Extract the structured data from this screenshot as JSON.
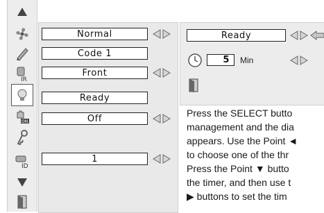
{
  "menu": {
    "fields": [
      {
        "label": "Normal",
        "arrows": true
      },
      {
        "label": "Code 1",
        "arrows": false
      },
      {
        "label": "Front",
        "arrows": true
      },
      {
        "label": "Ready",
        "arrows": false
      },
      {
        "label": "Off",
        "arrows": true
      },
      {
        "label": "1",
        "arrows": true
      }
    ]
  },
  "sidebar_icons": [
    "triangle-up-icon",
    "fan-icon",
    "pencil-icon",
    "remote-ir-icon",
    "lightbulb-icon",
    "power-on-hand-icon",
    "key-icon",
    "remote-id-icon",
    "triangle-down-icon",
    "exit-door-icon"
  ],
  "subpanel": {
    "status": "Ready",
    "timer_value": "5",
    "timer_unit": "Min"
  },
  "description": {
    "lines": [
      "Press the SELECT butto",
      "management and the dia",
      "appears. Use the Point ◄",
      "to choose one of the thr",
      "Press the Point ▼ butto",
      "the timer, and then use t",
      "▶ buttons to set the tim"
    ]
  },
  "colors": {
    "panel": "#e9e9e9",
    "field_border": "#222222",
    "arrow": "#c8c8c8"
  }
}
